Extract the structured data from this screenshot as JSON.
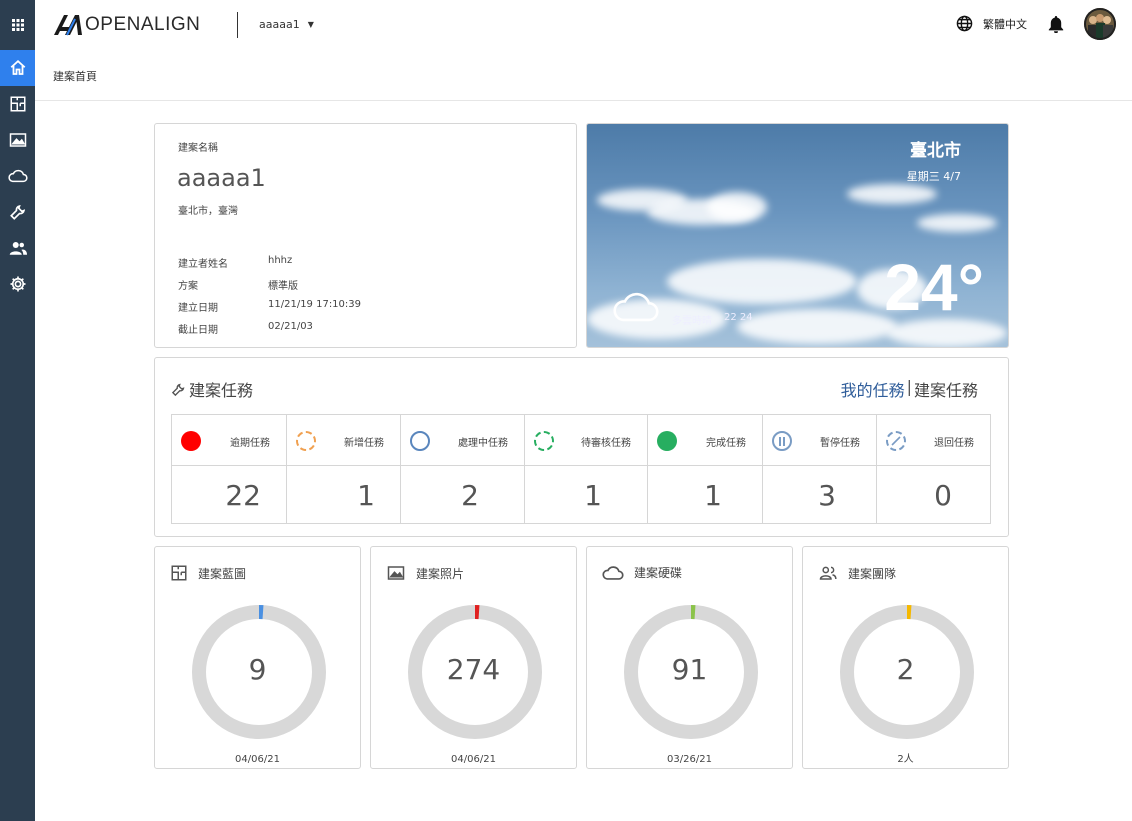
{
  "topbar": {
    "logo_text": "OPENALIGN",
    "project_name": "aaaaa1",
    "language": "繁體中文"
  },
  "breadcrumb": "建案首頁",
  "project": {
    "label": "建案名稱",
    "name": "aaaaa1",
    "location": "臺北市，臺灣",
    "fields": [
      {
        "key": "建立者姓名",
        "value": "hhhz"
      },
      {
        "key": "方案",
        "value": "標準版"
      },
      {
        "key": "建立日期",
        "value": "11/21/19 17:10:39"
      },
      {
        "key": "截止日期",
        "value": "02/21/03"
      }
    ]
  },
  "weather": {
    "city": "臺北市",
    "date": "星期三 4/7",
    "temperature": "24°",
    "description": "多雲時晴",
    "range": "22  24"
  },
  "tasks": {
    "title": "建案任務",
    "link_mine": "我的任務",
    "link_sep": "|",
    "link_all": "建案任務",
    "items": [
      {
        "label": "逾期任務",
        "count": "22",
        "color": "#ff0000",
        "style": "solid"
      },
      {
        "label": "新增任務",
        "count": "1",
        "color": "#f0a050",
        "style": "dashed"
      },
      {
        "label": "處理中任務",
        "count": "2",
        "color": "#5a86bd",
        "style": "ring"
      },
      {
        "label": "待審核任務",
        "count": "1",
        "color": "#27ae60",
        "style": "dashed"
      },
      {
        "label": "完成任務",
        "count": "1",
        "color": "#27ae60",
        "style": "solid"
      },
      {
        "label": "暫停任務",
        "count": "3",
        "color": "#7a9cc4",
        "style": "pause"
      },
      {
        "label": "退回任務",
        "count": "0",
        "color": "#7a9cc4",
        "style": "dashed-slash"
      }
    ]
  },
  "stats": [
    {
      "label": "建案藍圖",
      "value": "9",
      "footer": "04/06/21",
      "accent": "#4a90e2",
      "icon": "blueprint-icon"
    },
    {
      "label": "建案照片",
      "value": "274",
      "footer": "04/06/21",
      "accent": "#e02020",
      "icon": "image-icon"
    },
    {
      "label": "建案硬碟",
      "value": "91",
      "footer": "03/26/21",
      "accent": "#8bc34a",
      "icon": "cloud-icon"
    },
    {
      "label": "建案團隊",
      "value": "2",
      "footer": "2人",
      "accent": "#f5b800",
      "icon": "team-icon"
    }
  ]
}
